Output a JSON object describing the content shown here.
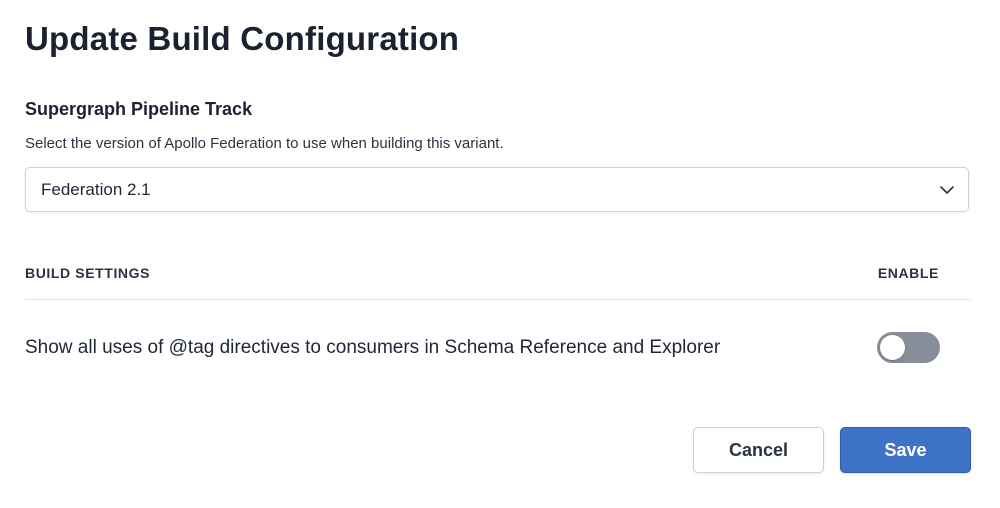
{
  "dialog": {
    "title": "Update Build Configuration"
  },
  "pipeline": {
    "heading": "Supergraph Pipeline Track",
    "description": "Select the version of Apollo Federation to use when building this variant.",
    "selected_value": "Federation 2.1"
  },
  "settings": {
    "column_label": "BUILD SETTINGS",
    "enable_label": "ENABLE",
    "rows": [
      {
        "label": "Show all uses of @tag directives to consumers in Schema Reference and Explorer",
        "enabled": false
      }
    ]
  },
  "actions": {
    "cancel_label": "Cancel",
    "save_label": "Save"
  },
  "colors": {
    "primary": "#3f73c7",
    "toggle_off": "#878e99",
    "border": "#cbd1da"
  },
  "icons": {
    "select_chevron": "chevron-down-icon"
  }
}
